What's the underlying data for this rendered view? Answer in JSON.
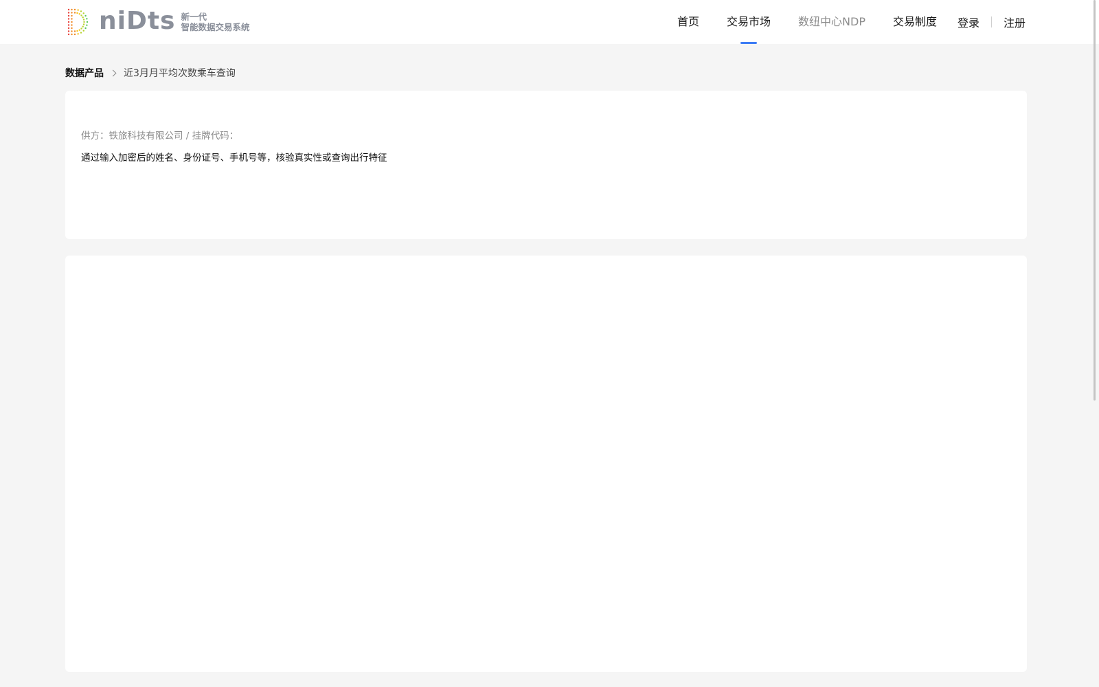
{
  "header": {
    "logo_word": "niDts",
    "logo_tagline_1": "新一代",
    "logo_tagline_2": "智能数据交易系统",
    "nav": [
      {
        "label": "首页"
      },
      {
        "label": "交易市场"
      },
      {
        "label": "数纽中心NDP"
      },
      {
        "label": "交易制度"
      }
    ],
    "login_label": "登录",
    "register_label": "注册",
    "active_color": "#3d7cf5"
  },
  "breadcrumb": {
    "root": "数据产品",
    "current": "近3月月平均次数乘车查询"
  },
  "product": {
    "supplier_line": "供方：铁旅科技有限公司 / 挂牌代码：",
    "description": "通过输入加密后的姓名、身份证号、手机号等，核验真实性或查询出行特征"
  }
}
